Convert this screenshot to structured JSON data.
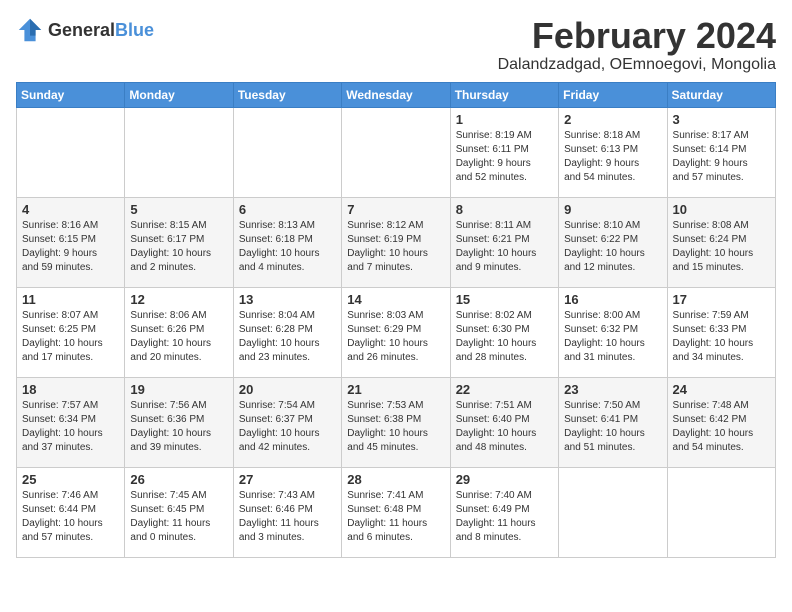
{
  "header": {
    "logo_general": "General",
    "logo_blue": "Blue",
    "month_year": "February 2024",
    "location": "Dalandzadgad, OEmnoegovi, Mongolia"
  },
  "days_of_week": [
    "Sunday",
    "Monday",
    "Tuesday",
    "Wednesday",
    "Thursday",
    "Friday",
    "Saturday"
  ],
  "weeks": [
    [
      {
        "day": "",
        "info": ""
      },
      {
        "day": "",
        "info": ""
      },
      {
        "day": "",
        "info": ""
      },
      {
        "day": "",
        "info": ""
      },
      {
        "day": "1",
        "info": "Sunrise: 8:19 AM\nSunset: 6:11 PM\nDaylight: 9 hours\nand 52 minutes."
      },
      {
        "day": "2",
        "info": "Sunrise: 8:18 AM\nSunset: 6:13 PM\nDaylight: 9 hours\nand 54 minutes."
      },
      {
        "day": "3",
        "info": "Sunrise: 8:17 AM\nSunset: 6:14 PM\nDaylight: 9 hours\nand 57 minutes."
      }
    ],
    [
      {
        "day": "4",
        "info": "Sunrise: 8:16 AM\nSunset: 6:15 PM\nDaylight: 9 hours\nand 59 minutes."
      },
      {
        "day": "5",
        "info": "Sunrise: 8:15 AM\nSunset: 6:17 PM\nDaylight: 10 hours\nand 2 minutes."
      },
      {
        "day": "6",
        "info": "Sunrise: 8:13 AM\nSunset: 6:18 PM\nDaylight: 10 hours\nand 4 minutes."
      },
      {
        "day": "7",
        "info": "Sunrise: 8:12 AM\nSunset: 6:19 PM\nDaylight: 10 hours\nand 7 minutes."
      },
      {
        "day": "8",
        "info": "Sunrise: 8:11 AM\nSunset: 6:21 PM\nDaylight: 10 hours\nand 9 minutes."
      },
      {
        "day": "9",
        "info": "Sunrise: 8:10 AM\nSunset: 6:22 PM\nDaylight: 10 hours\nand 12 minutes."
      },
      {
        "day": "10",
        "info": "Sunrise: 8:08 AM\nSunset: 6:24 PM\nDaylight: 10 hours\nand 15 minutes."
      }
    ],
    [
      {
        "day": "11",
        "info": "Sunrise: 8:07 AM\nSunset: 6:25 PM\nDaylight: 10 hours\nand 17 minutes."
      },
      {
        "day": "12",
        "info": "Sunrise: 8:06 AM\nSunset: 6:26 PM\nDaylight: 10 hours\nand 20 minutes."
      },
      {
        "day": "13",
        "info": "Sunrise: 8:04 AM\nSunset: 6:28 PM\nDaylight: 10 hours\nand 23 minutes."
      },
      {
        "day": "14",
        "info": "Sunrise: 8:03 AM\nSunset: 6:29 PM\nDaylight: 10 hours\nand 26 minutes."
      },
      {
        "day": "15",
        "info": "Sunrise: 8:02 AM\nSunset: 6:30 PM\nDaylight: 10 hours\nand 28 minutes."
      },
      {
        "day": "16",
        "info": "Sunrise: 8:00 AM\nSunset: 6:32 PM\nDaylight: 10 hours\nand 31 minutes."
      },
      {
        "day": "17",
        "info": "Sunrise: 7:59 AM\nSunset: 6:33 PM\nDaylight: 10 hours\nand 34 minutes."
      }
    ],
    [
      {
        "day": "18",
        "info": "Sunrise: 7:57 AM\nSunset: 6:34 PM\nDaylight: 10 hours\nand 37 minutes."
      },
      {
        "day": "19",
        "info": "Sunrise: 7:56 AM\nSunset: 6:36 PM\nDaylight: 10 hours\nand 39 minutes."
      },
      {
        "day": "20",
        "info": "Sunrise: 7:54 AM\nSunset: 6:37 PM\nDaylight: 10 hours\nand 42 minutes."
      },
      {
        "day": "21",
        "info": "Sunrise: 7:53 AM\nSunset: 6:38 PM\nDaylight: 10 hours\nand 45 minutes."
      },
      {
        "day": "22",
        "info": "Sunrise: 7:51 AM\nSunset: 6:40 PM\nDaylight: 10 hours\nand 48 minutes."
      },
      {
        "day": "23",
        "info": "Sunrise: 7:50 AM\nSunset: 6:41 PM\nDaylight: 10 hours\nand 51 minutes."
      },
      {
        "day": "24",
        "info": "Sunrise: 7:48 AM\nSunset: 6:42 PM\nDaylight: 10 hours\nand 54 minutes."
      }
    ],
    [
      {
        "day": "25",
        "info": "Sunrise: 7:46 AM\nSunset: 6:44 PM\nDaylight: 10 hours\nand 57 minutes."
      },
      {
        "day": "26",
        "info": "Sunrise: 7:45 AM\nSunset: 6:45 PM\nDaylight: 11 hours\nand 0 minutes."
      },
      {
        "day": "27",
        "info": "Sunrise: 7:43 AM\nSunset: 6:46 PM\nDaylight: 11 hours\nand 3 minutes."
      },
      {
        "day": "28",
        "info": "Sunrise: 7:41 AM\nSunset: 6:48 PM\nDaylight: 11 hours\nand 6 minutes."
      },
      {
        "day": "29",
        "info": "Sunrise: 7:40 AM\nSunset: 6:49 PM\nDaylight: 11 hours\nand 8 minutes."
      },
      {
        "day": "",
        "info": ""
      },
      {
        "day": "",
        "info": ""
      }
    ]
  ]
}
